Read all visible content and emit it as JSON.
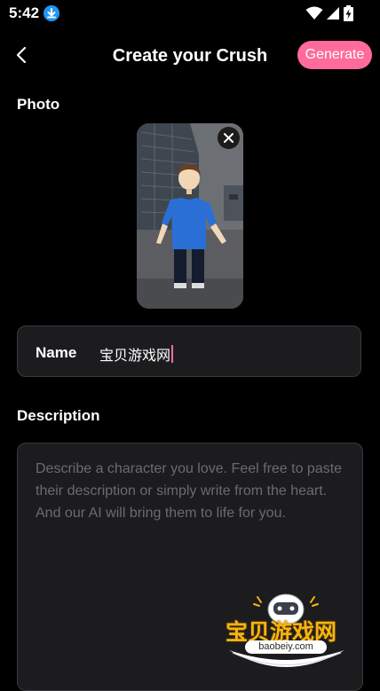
{
  "status_bar": {
    "time": "5:42",
    "icons": [
      "download-badge-icon",
      "wifi-icon",
      "signal-icon",
      "battery-charging-icon"
    ]
  },
  "header": {
    "back_icon": "chevron-left-icon",
    "title": "Create your Crush",
    "generate_label": "Generate"
  },
  "photo": {
    "label": "Photo",
    "remove_icon": "close-icon"
  },
  "name_field": {
    "label": "Name",
    "value": "宝贝游戏网"
  },
  "description": {
    "label": "Description",
    "placeholder": "Describe a character you love. Feel free to paste their description or simply write from the heart. And our AI will bring them to life for you."
  },
  "watermark": {
    "title": "宝贝游戏网",
    "domain": "baobeiy.com"
  },
  "colors": {
    "background": "#000000",
    "accent": "#ff6b9a",
    "field_background": "#1c1c1f",
    "placeholder": "#6b6b70",
    "status_download": "#2196f3"
  }
}
